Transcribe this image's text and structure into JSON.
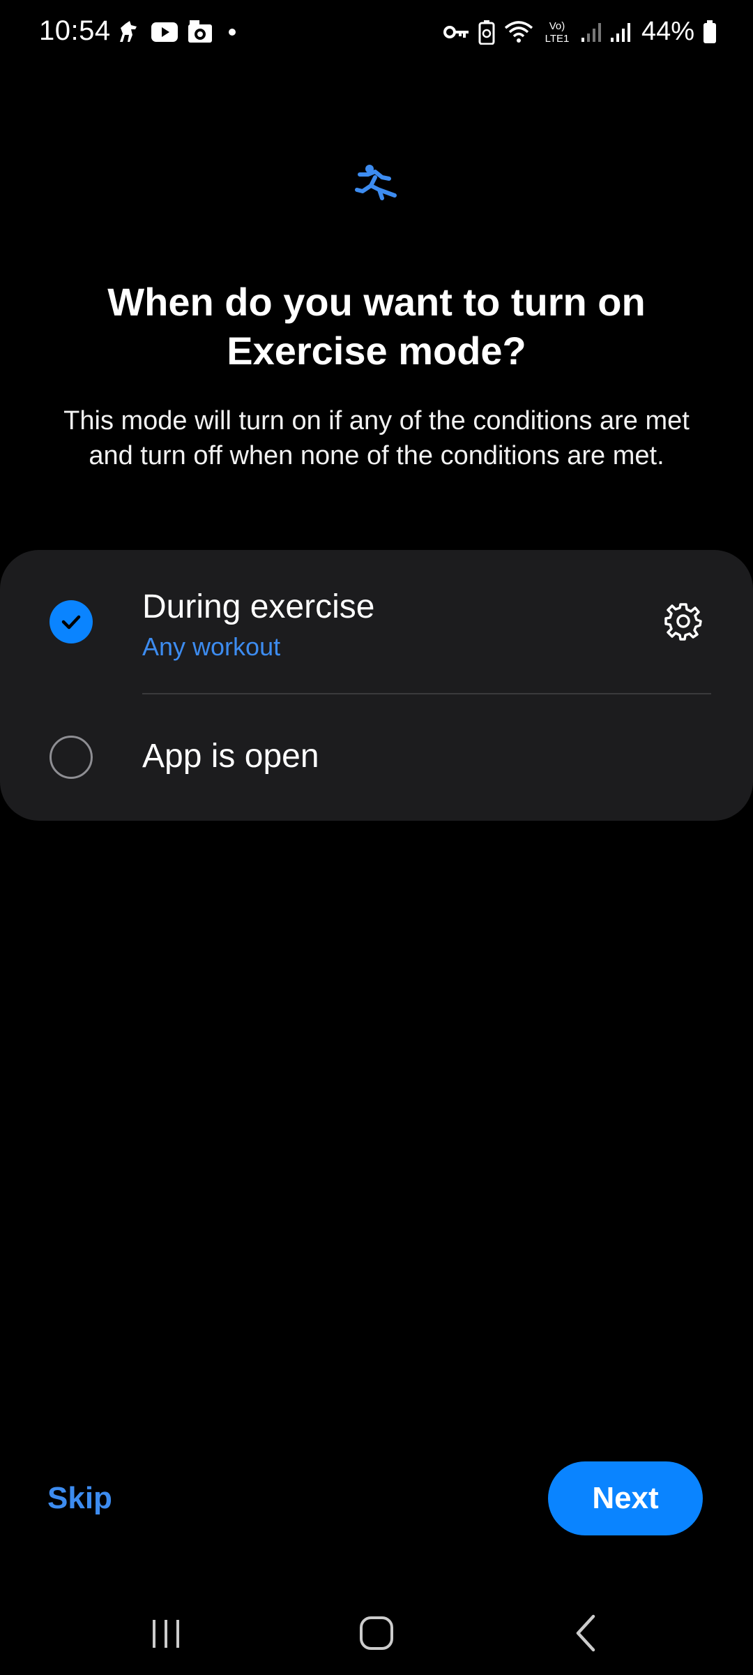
{
  "status_bar": {
    "time": "10:54",
    "battery": "44%",
    "network_label_top": "Vo)",
    "network_label_bottom": "LTE1",
    "left_icons": [
      "horse-app-icon",
      "youtube-icon",
      "camera-notification-icon",
      "dot-icon"
    ],
    "right_icons": [
      "vpn-key-icon",
      "battery-saver-icon",
      "wifi-icon",
      "volte-icon",
      "signal-icon",
      "signal-icon",
      "battery-icon"
    ]
  },
  "header": {
    "icon": "exercise-run-icon",
    "title": "When do you want to turn on Exercise mode?",
    "description": "This mode will turn on if any of the conditions are met and turn off when none of the conditions are met."
  },
  "options": [
    {
      "label": "During exercise",
      "sublabel": "Any workout",
      "selected": true,
      "settings_icon": "gear-icon"
    },
    {
      "label": "App is open",
      "selected": false
    }
  ],
  "footer": {
    "skip_label": "Skip",
    "next_label": "Next"
  },
  "nav_bar": {
    "icons": [
      "recents-icon",
      "home-icon",
      "back-icon"
    ]
  },
  "colors": {
    "accent": "#0a84ff",
    "link": "#3d8cf0",
    "card_bg": "#1c1c1e",
    "background": "#000000"
  }
}
